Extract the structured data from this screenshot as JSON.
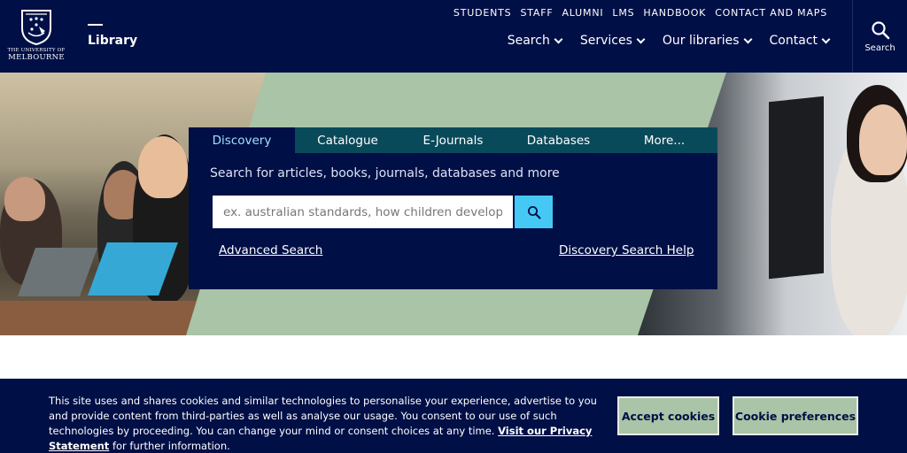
{
  "header": {
    "logo": {
      "line1": "THE UNIVERSITY OF",
      "line2": "MELBOURNE",
      "icon": "university-crest-icon"
    },
    "site_title": "Library",
    "top_links": [
      "STUDENTS",
      "STAFF",
      "ALUMNI",
      "LMS",
      "HANDBOOK",
      "CONTACT AND MAPS"
    ],
    "main_nav": [
      "Search",
      "Services",
      "Our libraries",
      "Contact"
    ],
    "search_label": "Search"
  },
  "search_panel": {
    "tabs": [
      "Discovery",
      "Catalogue",
      "E-Journals",
      "Databases",
      "More..."
    ],
    "active_tab": "Discovery",
    "description": "Search for articles, books, journals, databases and more",
    "input_placeholder": "ex. australian standards, how children develop, PMID",
    "input_value": "",
    "advanced_link": "Advanced Search",
    "help_link": "Discovery Search Help"
  },
  "cookie_banner": {
    "text": "This site uses and shares cookies and similar technologies to personalise your experience, advertise to you and provide content from third-parties as well as analyse our usage. You consent to our use of such technologies by proceeding. You can change your mind or consent choices at any time.",
    "privacy_link": "Visit our Privacy Statement",
    "text_end": "for further information.",
    "accept_label": "Accept cookies",
    "prefs_label": "Cookie preferences"
  },
  "colors": {
    "navy": "#000f46",
    "sage": "#a9c4a6",
    "tab_teal": "#094a5a",
    "accent_blue": "#46c8f5",
    "active_tab_text": "#9fe0ff"
  }
}
